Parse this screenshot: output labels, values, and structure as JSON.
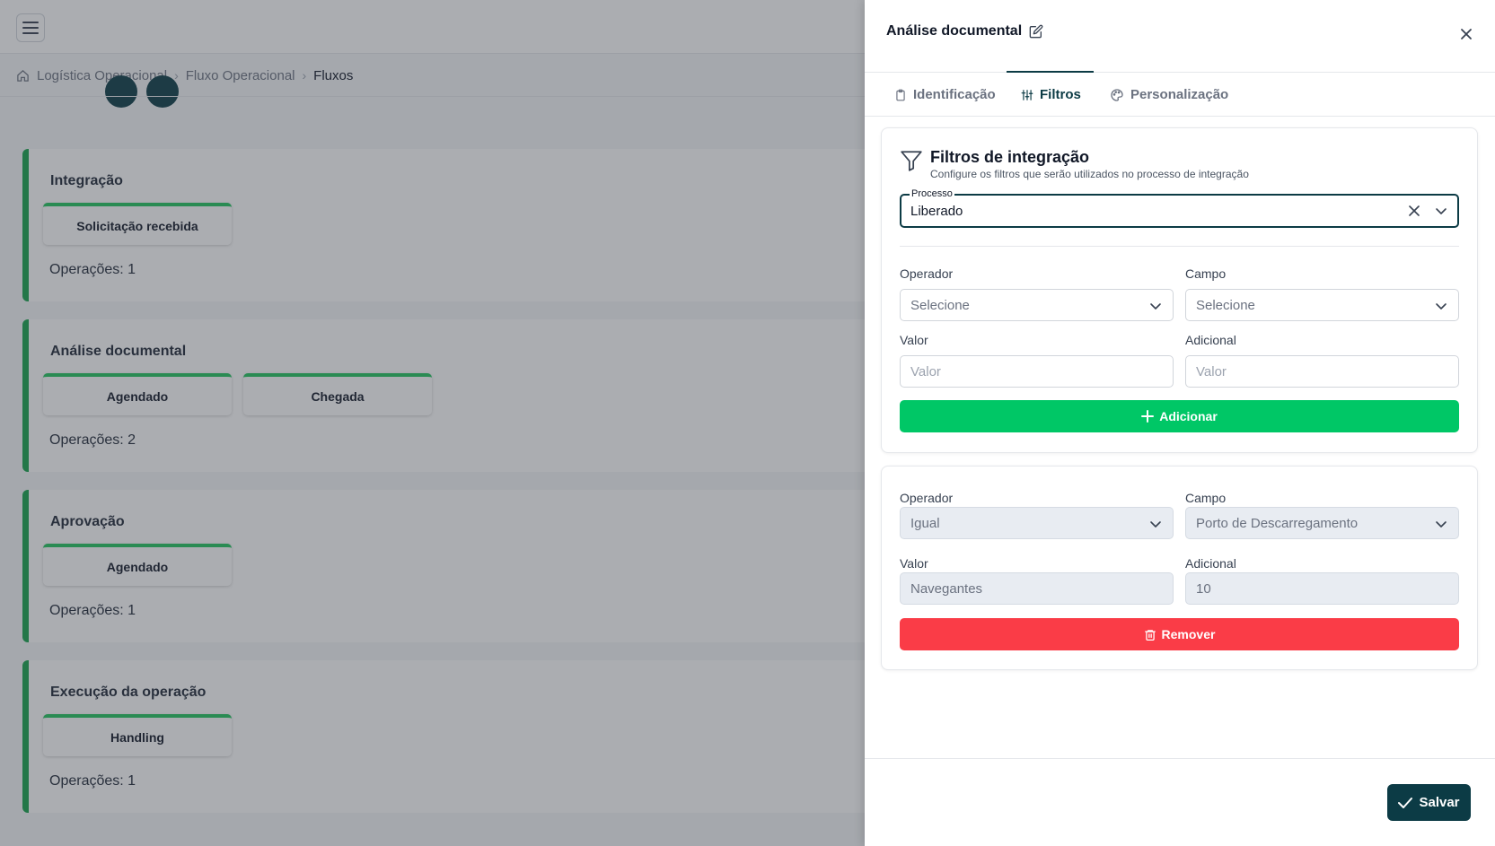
{
  "breadcrumb": {
    "items": [
      "Logística Operacional",
      "Fluxo Operacional"
    ],
    "current": "Fluxos"
  },
  "stages": [
    {
      "title": "Integração",
      "operations": [
        "Solicitação recebida"
      ],
      "count_text": "Operações: 1"
    },
    {
      "title": "Análise documental",
      "operations": [
        "Agendado",
        "Chegada"
      ],
      "count_text": "Operações: 2"
    },
    {
      "title": "Aprovação",
      "operations": [
        "Agendado"
      ],
      "count_text": "Operações: 1"
    },
    {
      "title": "Execução da operação",
      "operations": [
        "Handling"
      ],
      "count_text": "Operações: 1"
    }
  ],
  "drawer": {
    "title": "Análise documental",
    "tabs": [
      {
        "label": "Identificação",
        "icon": "clipboard-icon"
      },
      {
        "label": "Filtros",
        "icon": "sliders-icon",
        "active": true
      },
      {
        "label": "Personalização",
        "icon": "palette-icon"
      }
    ],
    "filters_card": {
      "title": "Filtros de integração",
      "subtitle": "Configure os filtros que serão utilizados no processo de integração",
      "process_label": "Processo",
      "process_value": "Liberado",
      "operator_label": "Operador",
      "operator_placeholder": "Selecione",
      "field_label": "Campo",
      "field_placeholder": "Selecione",
      "value_label": "Valor",
      "value_placeholder": "Valor",
      "additional_label": "Adicional",
      "additional_placeholder": "Valor",
      "add_button": "Adicionar"
    },
    "existing_filter": {
      "operator_label": "Operador",
      "operator_value": "Igual",
      "field_label": "Campo",
      "field_value": "Porto de Descarregamento",
      "value_label": "Valor",
      "value_value": "Navegantes",
      "additional_label": "Adicional",
      "additional_value": "10",
      "remove_button": "Remover"
    },
    "save_button": "Salvar"
  },
  "colors": {
    "primary": "#0c3b45",
    "success": "#00c766",
    "danger": "#fa3c47",
    "stage_border": "#16a34a"
  }
}
